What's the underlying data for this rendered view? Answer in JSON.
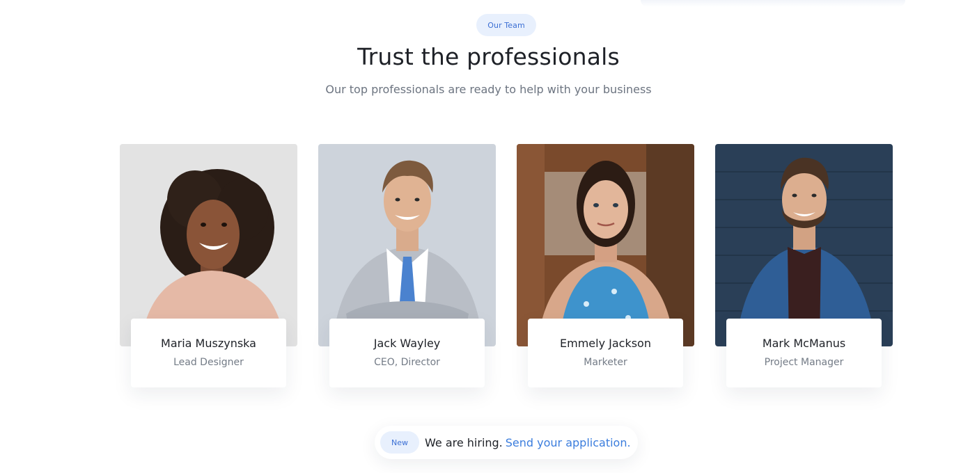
{
  "section": {
    "eyebrow": "Our Team",
    "title": "Trust the professionals",
    "subtitle": "Our top professionals are ready to help with your business"
  },
  "team": [
    {
      "name": "Maria Muszynska",
      "role": "Lead Designer",
      "photo": "woman-curly-hair-photo"
    },
    {
      "name": "Jack Wayley",
      "role": "CEO, Director",
      "photo": "man-grey-suit-photo"
    },
    {
      "name": "Emmely Jackson",
      "role": "Marketer",
      "photo": "woman-blue-floral-top-photo"
    },
    {
      "name": "Mark McManus",
      "role": "Project Manager",
      "photo": "man-blue-blazer-photo"
    }
  ],
  "hiring": {
    "badge": "New",
    "text": "We are hiring.",
    "link": "Send your application."
  },
  "colors": {
    "accent": "#3b7ddd",
    "badge_bg": "#e8f0fd",
    "heading": "#1e2127",
    "muted": "#737b86"
  }
}
